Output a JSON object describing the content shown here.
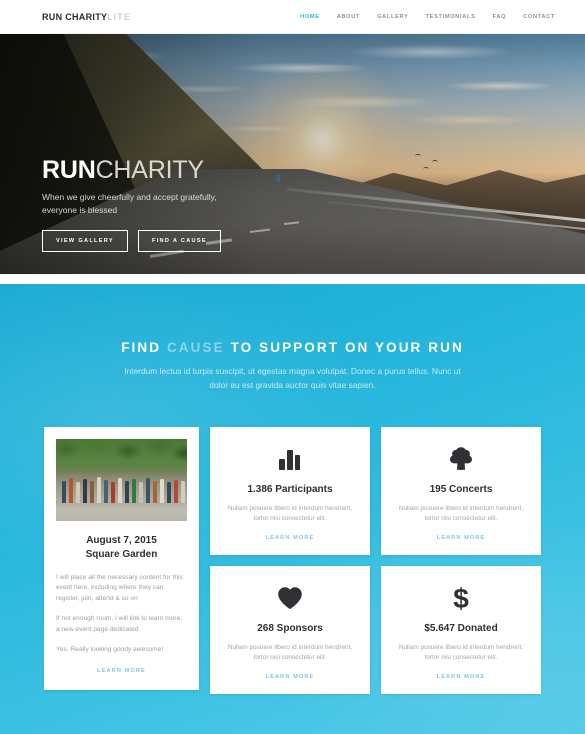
{
  "header": {
    "logo_main": "RUN CHARITY",
    "logo_lite": "LITE",
    "nav": [
      {
        "label": "HOME",
        "active": true
      },
      {
        "label": "ABOUT",
        "active": false
      },
      {
        "label": "GALLERY",
        "active": false
      },
      {
        "label": "TESTIMONIALS",
        "active": false
      },
      {
        "label": "FAQ",
        "active": false
      },
      {
        "label": "CONTACT",
        "active": false
      }
    ]
  },
  "hero": {
    "title_bold": "RUN",
    "title_light": "CHARITY",
    "subtitle": "When we give cheerfully and accept gratefully, everyone is blessed",
    "button_primary": "VIEW GALLERY",
    "button_secondary": "FIND A CAUSE"
  },
  "section": {
    "title_part1": "FIND",
    "title_part2": "CAUSE",
    "title_part3": "TO SUPPORT ON YOUR RUN",
    "subtitle": "Interdum lectus id turpis suscipit, ut egestas magna volutpat. Donec a purus tellus. Nunc ut dolor eu est gravida auctor quis vitae sapien."
  },
  "event_card": {
    "photo_alt": "runners-crowd-photo",
    "date": "August 7, 2015",
    "venue": "Square Garden",
    "paragraph1": "I will place all the necessary content for this event here, including where they can register, join, attend & so on",
    "paragraph2": "If not enough room, I will link to learn more, a new event page dedicated",
    "paragraph3": "Yes. Really looking goody awesome!",
    "learn_more": "LEARN MORE"
  },
  "stats": [
    {
      "icon": "bar-chart-icon",
      "title": "1.386 Participants",
      "description": "Nullam posuere libero id interdum hendrerit, tortor nisi consectetur elit.",
      "learn_more": "LEARN MORE"
    },
    {
      "icon": "tree-icon",
      "title": "195 Concerts",
      "description": "Nullam posuere libero id interdum hendrerit, tortor nisi consectetur elit.",
      "learn_more": "LEARN MORE"
    },
    {
      "icon": "heart-icon",
      "title": "268 Sponsors",
      "description": "Nullam posuere libero id interdum hendrerit, tortor nisi consectetur elit.",
      "learn_more": "LEARN MORE"
    },
    {
      "icon": "dollar-icon",
      "title": "$5.647 Donated",
      "description": "Nullam posuere libero id interdum hendrerit, tortor nisi consectetur elit.",
      "learn_more": "LEARN MORE"
    }
  ],
  "colors": {
    "accent_cyan": "#2bb7e0",
    "section_blue": "#28b7dd",
    "link_blue": "#7ec6e8",
    "text_dark": "#2e3033",
    "text_muted": "#9ba0a4"
  }
}
